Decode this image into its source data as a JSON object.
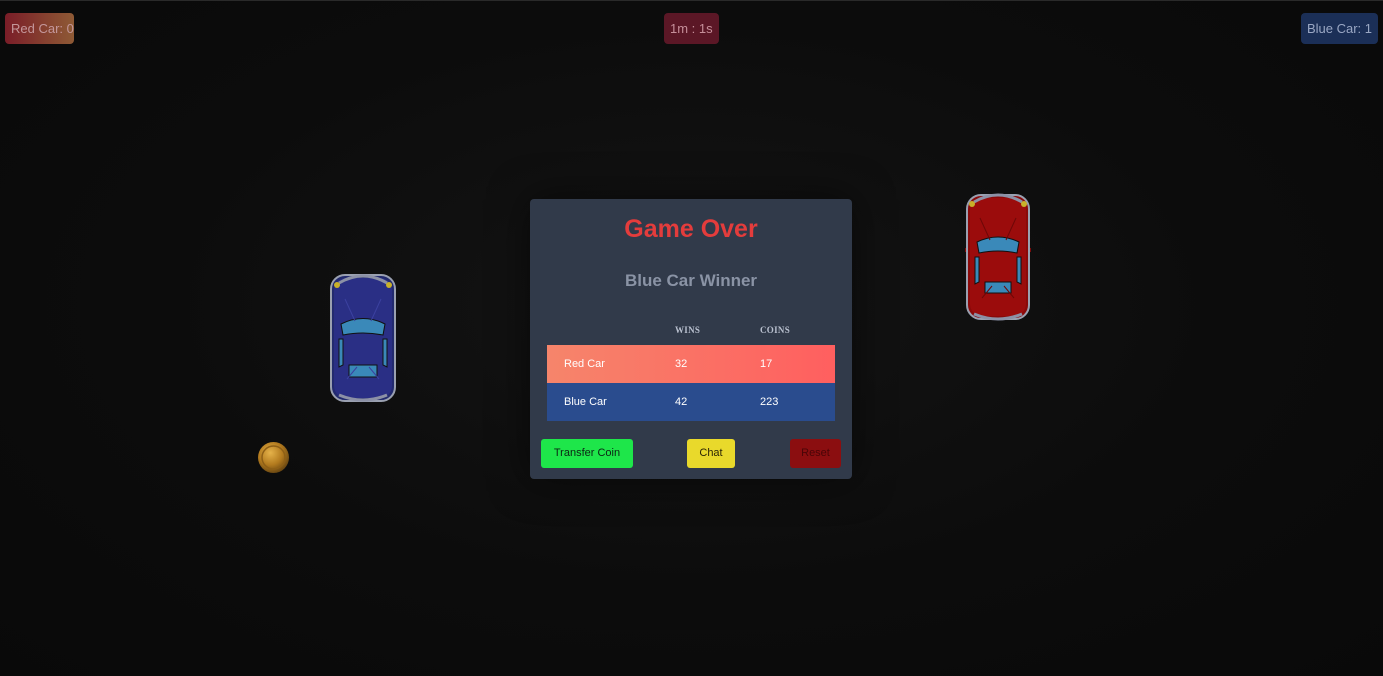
{
  "hud": {
    "red_score": "Red Car: 0",
    "timer": "1m : 1s",
    "blue_score": "Blue Car: 1"
  },
  "modal": {
    "title": "Game Over",
    "subtitle": "Blue Car Winner",
    "columns": [
      "",
      "WINS",
      "COINS"
    ],
    "rows": [
      {
        "name": "Red Car",
        "wins": "32",
        "coins": "17"
      },
      {
        "name": "Blue Car",
        "wins": "42",
        "coins": "223"
      }
    ],
    "buttons": {
      "transfer": "Transfer Coin",
      "chat": "Chat",
      "reset": "Reset"
    }
  },
  "icons": {
    "blue_car": "car-top-view-blue",
    "red_car": "car-top-view-red",
    "coin": "gold-coin"
  },
  "colors": {
    "background": "#0b0b0b",
    "modal": "#313a4a",
    "title": "#e43c3c",
    "red_row": "#f6856b",
    "blue_row": "#2a4c8e",
    "transfer_button": "#1ee64a",
    "chat_button": "#e9d92b",
    "reset_button": "#8b0e10"
  }
}
